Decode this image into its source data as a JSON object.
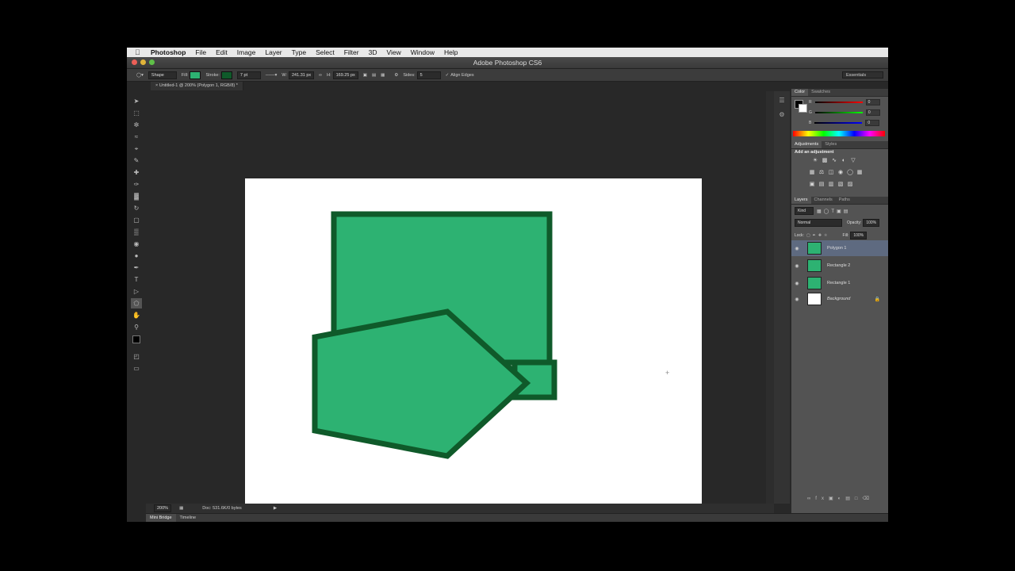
{
  "menubar": {
    "app": "Photoshop",
    "items": [
      "File",
      "Edit",
      "Image",
      "Layer",
      "Type",
      "Select",
      "Filter",
      "3D",
      "View",
      "Window",
      "Help"
    ]
  },
  "titlebar": {
    "title": "Adobe Photoshop CS6"
  },
  "options": {
    "tool_mode": "Shape",
    "fill_label": "Fill:",
    "stroke_label": "Stroke:",
    "stroke_width": "7 pt",
    "w_label": "W:",
    "w_value": "241.31 px",
    "h_label": "H:",
    "h_value": "169.25 px",
    "sides_label": "Sides:",
    "sides_value": "5",
    "align_edges": "Align Edges",
    "workspace": "Essentials"
  },
  "document": {
    "tab": "Untitled-1 @ 200% (Polygon 1, RGB/8) *"
  },
  "status": {
    "zoom": "200%",
    "doc": "Doc: 531.6K/0 bytes"
  },
  "bottom_tabs": [
    "Mini Bridge",
    "Timeline"
  ],
  "color_panel": {
    "tabs": [
      "Color",
      "Swatches"
    ],
    "channels": [
      {
        "label": "R",
        "value": "0"
      },
      {
        "label": "G",
        "value": "0"
      },
      {
        "label": "B",
        "value": "0"
      }
    ]
  },
  "adjustments_panel": {
    "tabs": [
      "Adjustments",
      "Styles"
    ],
    "heading": "Add an adjustment"
  },
  "layers_panel": {
    "tabs": [
      "Layers",
      "Channels",
      "Paths"
    ],
    "kind": "Kind",
    "blend": "Normal",
    "opacity_label": "Opacity:",
    "opacity_value": "100%",
    "lock_label": "Lock:",
    "fill_label": "Fill:",
    "fill_value": "100%",
    "layers": [
      {
        "name": "Polygon 1",
        "selected": true
      },
      {
        "name": "Rectangle 2",
        "selected": false
      },
      {
        "name": "Rectangle 1",
        "selected": false
      },
      {
        "name": "Background",
        "selected": false
      }
    ]
  },
  "colors": {
    "shape_fill": "#2db272",
    "shape_stroke": "#0f5a2a",
    "selection": "#5e6a80"
  }
}
